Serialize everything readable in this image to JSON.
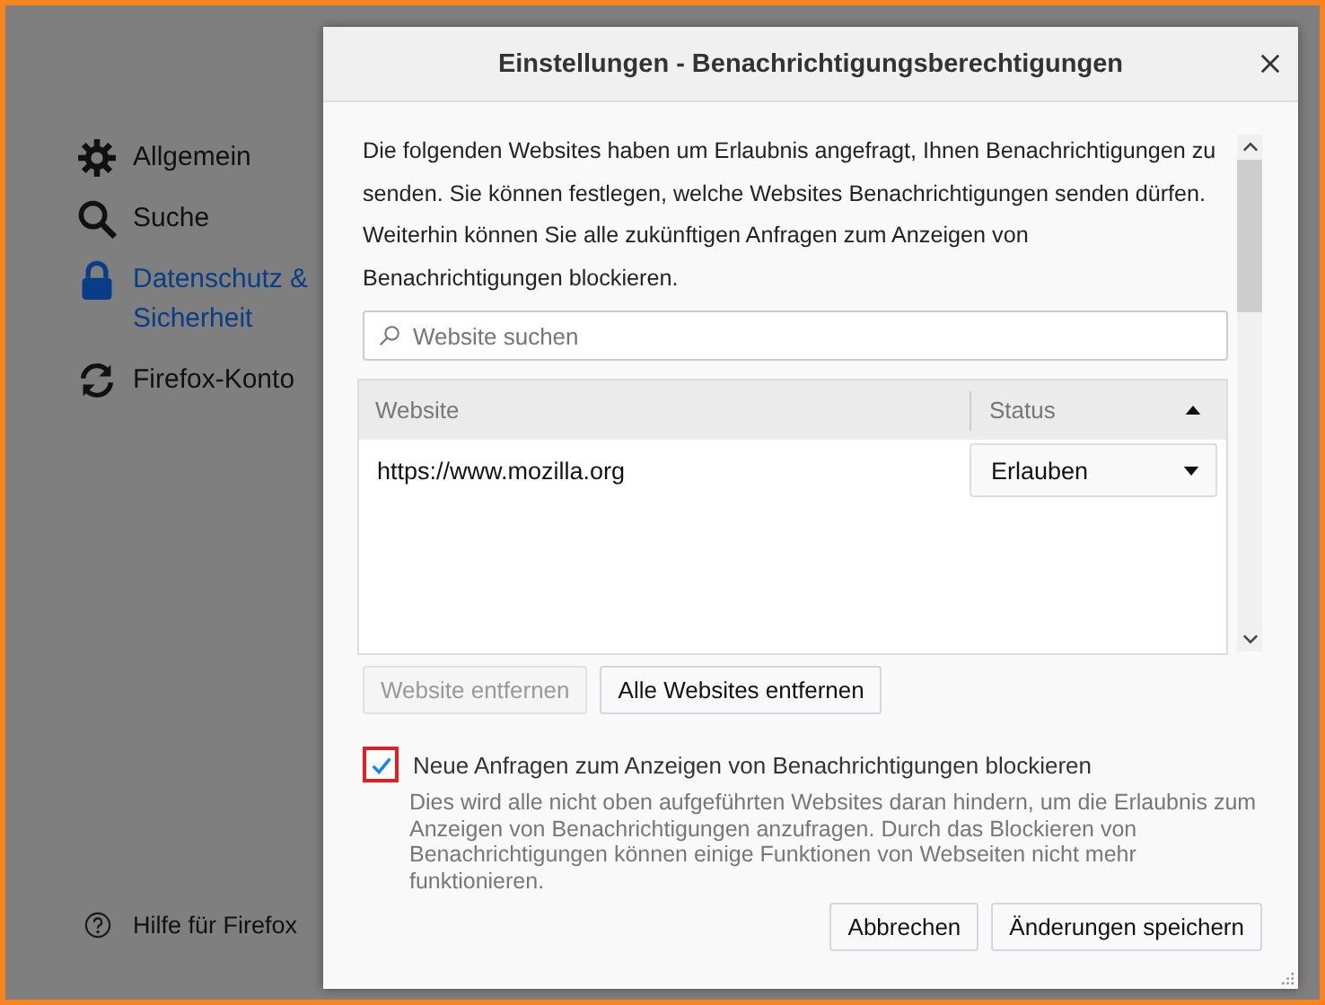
{
  "sidebar": {
    "items": [
      {
        "kind": "gear",
        "label": "Allgemein",
        "selected": false
      },
      {
        "kind": "search",
        "label": "Suche",
        "selected": false
      },
      {
        "kind": "lock",
        "label": "Datenschutz & Sicherheit",
        "selected": true
      },
      {
        "kind": "sync",
        "label": "Firefox-Konto",
        "selected": false
      }
    ],
    "help_link": "Hilfe für Firefox"
  },
  "dialog": {
    "title": "Einstellungen - Benachrichtigungsberechtigungen",
    "intro": "Die folgenden Websites haben um Erlaubnis angefragt, Ihnen Benachrichtigungen zu senden. Sie können festlegen, welche Websites Benachrichtigungen senden dürfen. Weiterhin können Sie alle zukünftigen Anfragen zum Anzeigen von Benachrichtigungen blockieren.",
    "search": {
      "placeholder": "Website suchen"
    },
    "table": {
      "columns": [
        {
          "label": "Website"
        },
        {
          "label": "Status"
        }
      ],
      "rows": [
        {
          "website": "https://www.mozilla.org",
          "status": "Erlauben"
        }
      ]
    },
    "buttons": [
      {
        "label": "Website entfernen",
        "disabled": true
      },
      {
        "label": "Alle Websites entfernen",
        "disabled": false
      }
    ],
    "block_checkbox": {
      "label": "Neue Anfragen zum Anzeigen von Benachrichtigungen blockieren",
      "checked": true,
      "focused": true
    },
    "description": "Dies wird alle nicht oben aufgeführten Websites daran hindern, um die Erlaubnis zum Anzeigen von Benachrichtigungen anzufragen. Durch das Blockieren von Benachrichtigungen können einige Funktionen von Webseiten nicht mehr funktionieren.",
    "footer_buttons": [
      {
        "label": "Abbrechen"
      },
      {
        "label": "Änderungen speichern"
      }
    ]
  }
}
